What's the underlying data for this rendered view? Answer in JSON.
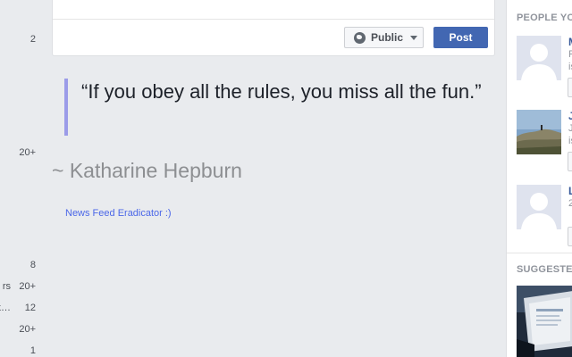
{
  "left_nav": {
    "rows": [
      {
        "label": "",
        "count": "2"
      },
      {
        "label": "",
        "count": "20+"
      },
      {
        "label": "",
        "count": "8"
      },
      {
        "label": "rs",
        "count": "20+"
      },
      {
        "label": "ck…",
        "count": "12"
      },
      {
        "label": "",
        "count": "20+"
      },
      {
        "label": "",
        "count": "1"
      }
    ]
  },
  "composer": {
    "privacy_label": "Public",
    "post_label": "Post"
  },
  "quote": {
    "text": "“If you obey all the rules, you miss all the fun.”",
    "author": "~ Katharine Hepburn",
    "credit": "News Feed Eradicator :)"
  },
  "right_col": {
    "people_title": "PEOPLE YOU MAY KNOW",
    "suggested_title": "SUGGESTED PAGES",
    "people": [
      {
        "name": "M",
        "line1": "F",
        "line2": "is"
      },
      {
        "name": "J",
        "line1": "J",
        "line2": "is"
      },
      {
        "name": "L",
        "line1": "2",
        "line2": ""
      }
    ]
  },
  "colors": {
    "accent": "#4267b2",
    "quote_bar": "#9b9be8",
    "credit_link": "#4b67e8",
    "background": "#e9ebee"
  }
}
